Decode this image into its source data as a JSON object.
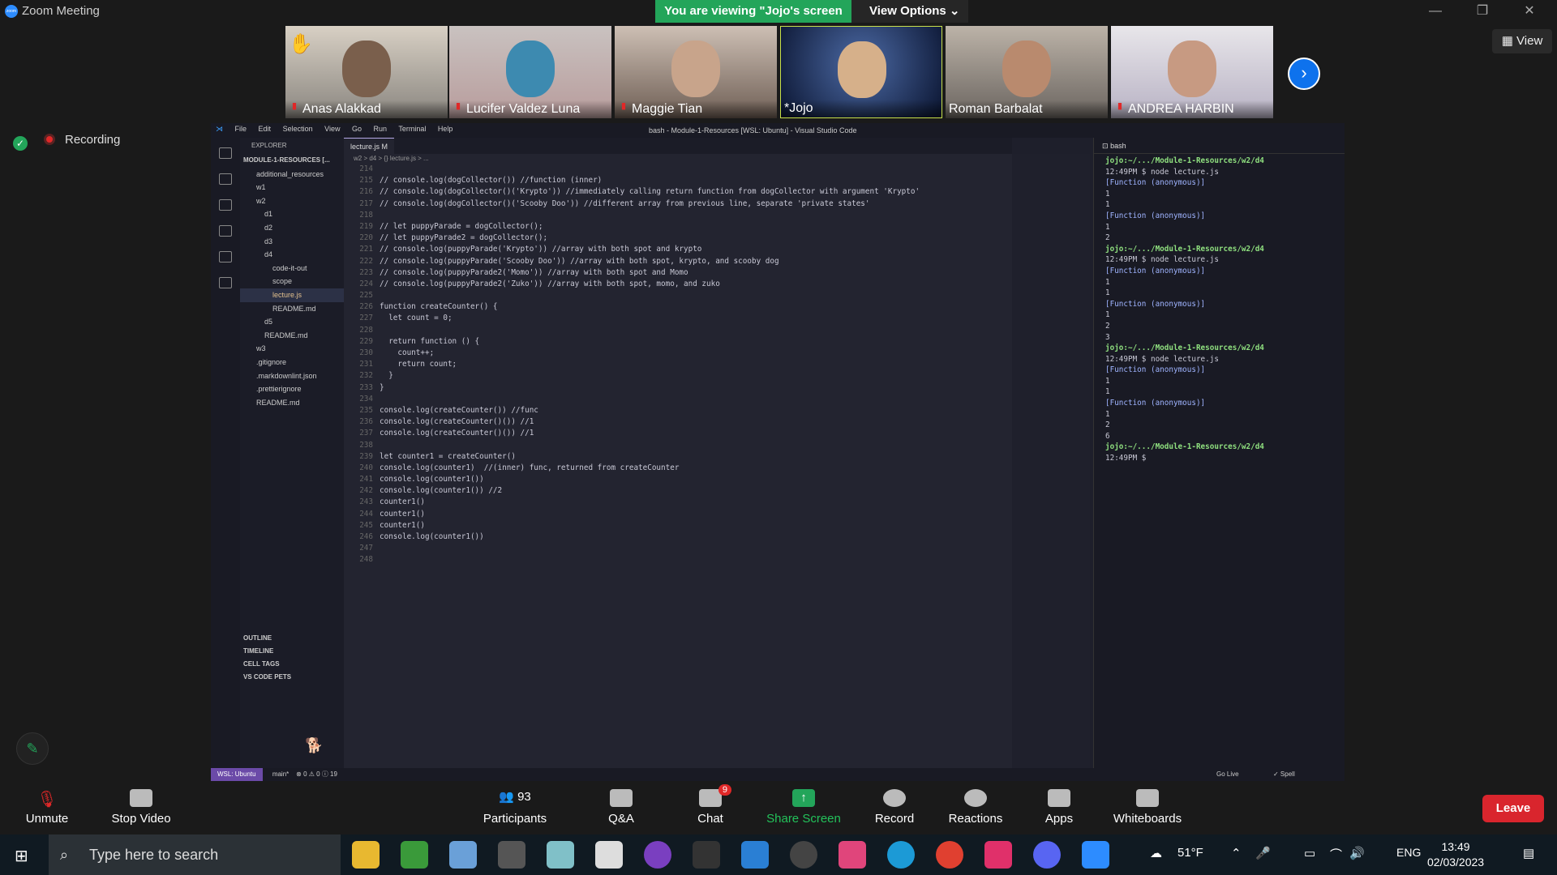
{
  "window": {
    "title": "Zoom Meeting",
    "logo_text": "zoom",
    "viewing_banner": "You are viewing \"Jojo's screen",
    "view_options": "View Options",
    "view_button": "View",
    "recording": "Recording"
  },
  "participants": [
    {
      "name": "Anas Alakkad",
      "muted": true,
      "hand": true
    },
    {
      "name": "Lucifer Valdez Luna (ze...",
      "muted": true
    },
    {
      "name": "Maggie Tian",
      "muted": true
    },
    {
      "name": "*Jojo",
      "muted": false
    },
    {
      "name": "Roman Barbalat",
      "muted": false
    },
    {
      "name": "ANDREA HARBIN",
      "muted": true
    }
  ],
  "vscode": {
    "menu": [
      "File",
      "Edit",
      "Selection",
      "View",
      "Go",
      "Run",
      "Terminal",
      "Help"
    ],
    "title": "bash - Module-1-Resources [WSL: Ubuntu] - Visual Studio Code",
    "explorer_header": "EXPLORER",
    "folder": "MODULE-1-RESOURCES [...",
    "tree": [
      "additional_resources",
      "w1",
      "w2",
      "d1",
      "d2",
      "d3",
      "d4",
      "code-it-out",
      "scope",
      "lecture.js",
      "README.md",
      "d5",
      "README.md",
      "w3",
      ".gitignore",
      ".markdownlint.json",
      ".prettierignore",
      "README.md"
    ],
    "sections": [
      "OUTLINE",
      "TIMELINE",
      "CELL TAGS",
      "VS CODE PETS"
    ],
    "tab": "lecture.js M",
    "breadcrumb": "w2 > d4 > {} lecture.js > ...",
    "code_lines": [
      [
        "214",
        ""
      ],
      [
        "215",
        "// console.log(dogCollector()) //function (inner)"
      ],
      [
        "216",
        "// console.log(dogCollector()('Krypto')) //immediately calling return function from dogCollector with argument 'Krypto'"
      ],
      [
        "217",
        "// console.log(dogCollector()('Scooby Doo')) //different array from previous line, separate 'private states'"
      ],
      [
        "218",
        ""
      ],
      [
        "219",
        "// let puppyParade = dogCollector();"
      ],
      [
        "220",
        "// let puppyParade2 = dogCollector();"
      ],
      [
        "221",
        "// console.log(puppyParade('Krypto')) //array with both spot and krypto"
      ],
      [
        "222",
        "// console.log(puppyParade('Scooby Doo')) //array with both spot, krypto, and scooby dog"
      ],
      [
        "223",
        "// console.log(puppyParade2('Momo')) //array with both spot and Momo"
      ],
      [
        "224",
        "// console.log(puppyParade2('Zuko')) //array with both spot, momo, and zuko"
      ],
      [
        "225",
        ""
      ],
      [
        "226",
        "function createCounter() {"
      ],
      [
        "227",
        "  let count = 0;"
      ],
      [
        "228",
        ""
      ],
      [
        "229",
        "  return function () {"
      ],
      [
        "230",
        "    count++;"
      ],
      [
        "231",
        "    return count;"
      ],
      [
        "232",
        "  }"
      ],
      [
        "233",
        "}"
      ],
      [
        "234",
        ""
      ],
      [
        "235",
        "console.log(createCounter()) //func"
      ],
      [
        "236",
        "console.log(createCounter()()) //1"
      ],
      [
        "237",
        "console.log(createCounter()()) //1"
      ],
      [
        "238",
        ""
      ],
      [
        "239",
        "let counter1 = createCounter()"
      ],
      [
        "240",
        "console.log(counter1)  //(inner) func, returned from createCounter"
      ],
      [
        "241",
        "console.log(counter1())"
      ],
      [
        "242",
        "console.log(counter1()) //2"
      ],
      [
        "243",
        "counter1()"
      ],
      [
        "244",
        "counter1()"
      ],
      [
        "245",
        "counter1()"
      ],
      [
        "246",
        "console.log(counter1())"
      ],
      [
        "247",
        ""
      ],
      [
        "248",
        ""
      ]
    ],
    "terminal_tab": "bash",
    "terminal_lines": [
      [
        "p",
        "jojo:~/.../Module-1-Resources/w2/d4"
      ],
      [
        "c",
        "12:49PM $ node lecture.js"
      ],
      [
        "f",
        "[Function (anonymous)]"
      ],
      [
        "o",
        "1"
      ],
      [
        "o",
        "1"
      ],
      [
        "f",
        "[Function (anonymous)]"
      ],
      [
        "o",
        "1"
      ],
      [
        "o",
        "2"
      ],
      [
        "p",
        "jojo:~/.../Module-1-Resources/w2/d4"
      ],
      [
        "c",
        "12:49PM $ node lecture.js"
      ],
      [
        "f",
        "[Function (anonymous)]"
      ],
      [
        "o",
        "1"
      ],
      [
        "o",
        "1"
      ],
      [
        "f",
        "[Function (anonymous)]"
      ],
      [
        "o",
        "1"
      ],
      [
        "o",
        "2"
      ],
      [
        "o",
        "3"
      ],
      [
        "p",
        "jojo:~/.../Module-1-Resources/w2/d4"
      ],
      [
        "c",
        "12:49PM $ node lecture.js"
      ],
      [
        "f",
        "[Function (anonymous)]"
      ],
      [
        "o",
        "1"
      ],
      [
        "o",
        "1"
      ],
      [
        "f",
        "[Function (anonymous)]"
      ],
      [
        "o",
        "1"
      ],
      [
        "o",
        "2"
      ],
      [
        "o",
        "6"
      ],
      [
        "p",
        "jojo:~/.../Module-1-Resources/w2/d4"
      ],
      [
        "c",
        "12:49PM $ "
      ]
    ],
    "status": {
      "wsl": "WSL: Ubuntu",
      "branch": "main*",
      "problems": "⊗ 0 ⚠ 0 ⓘ 19",
      "golive": "Go Live",
      "spell": "✓ Spell"
    }
  },
  "toolbar": {
    "unmute": "Unmute",
    "stop_video": "Stop Video",
    "participants": "Participants",
    "participants_count": "93",
    "qa": "Q&A",
    "chat": "Chat",
    "chat_badge": "9",
    "share": "Share Screen",
    "record": "Record",
    "reactions": "Reactions",
    "apps": "Apps",
    "whiteboards": "Whiteboards",
    "leave": "Leave"
  },
  "taskbar": {
    "search_placeholder": "Type here to search",
    "temp": "51°F",
    "lang": "ENG",
    "time": "13:49",
    "date": "02/03/2023"
  }
}
